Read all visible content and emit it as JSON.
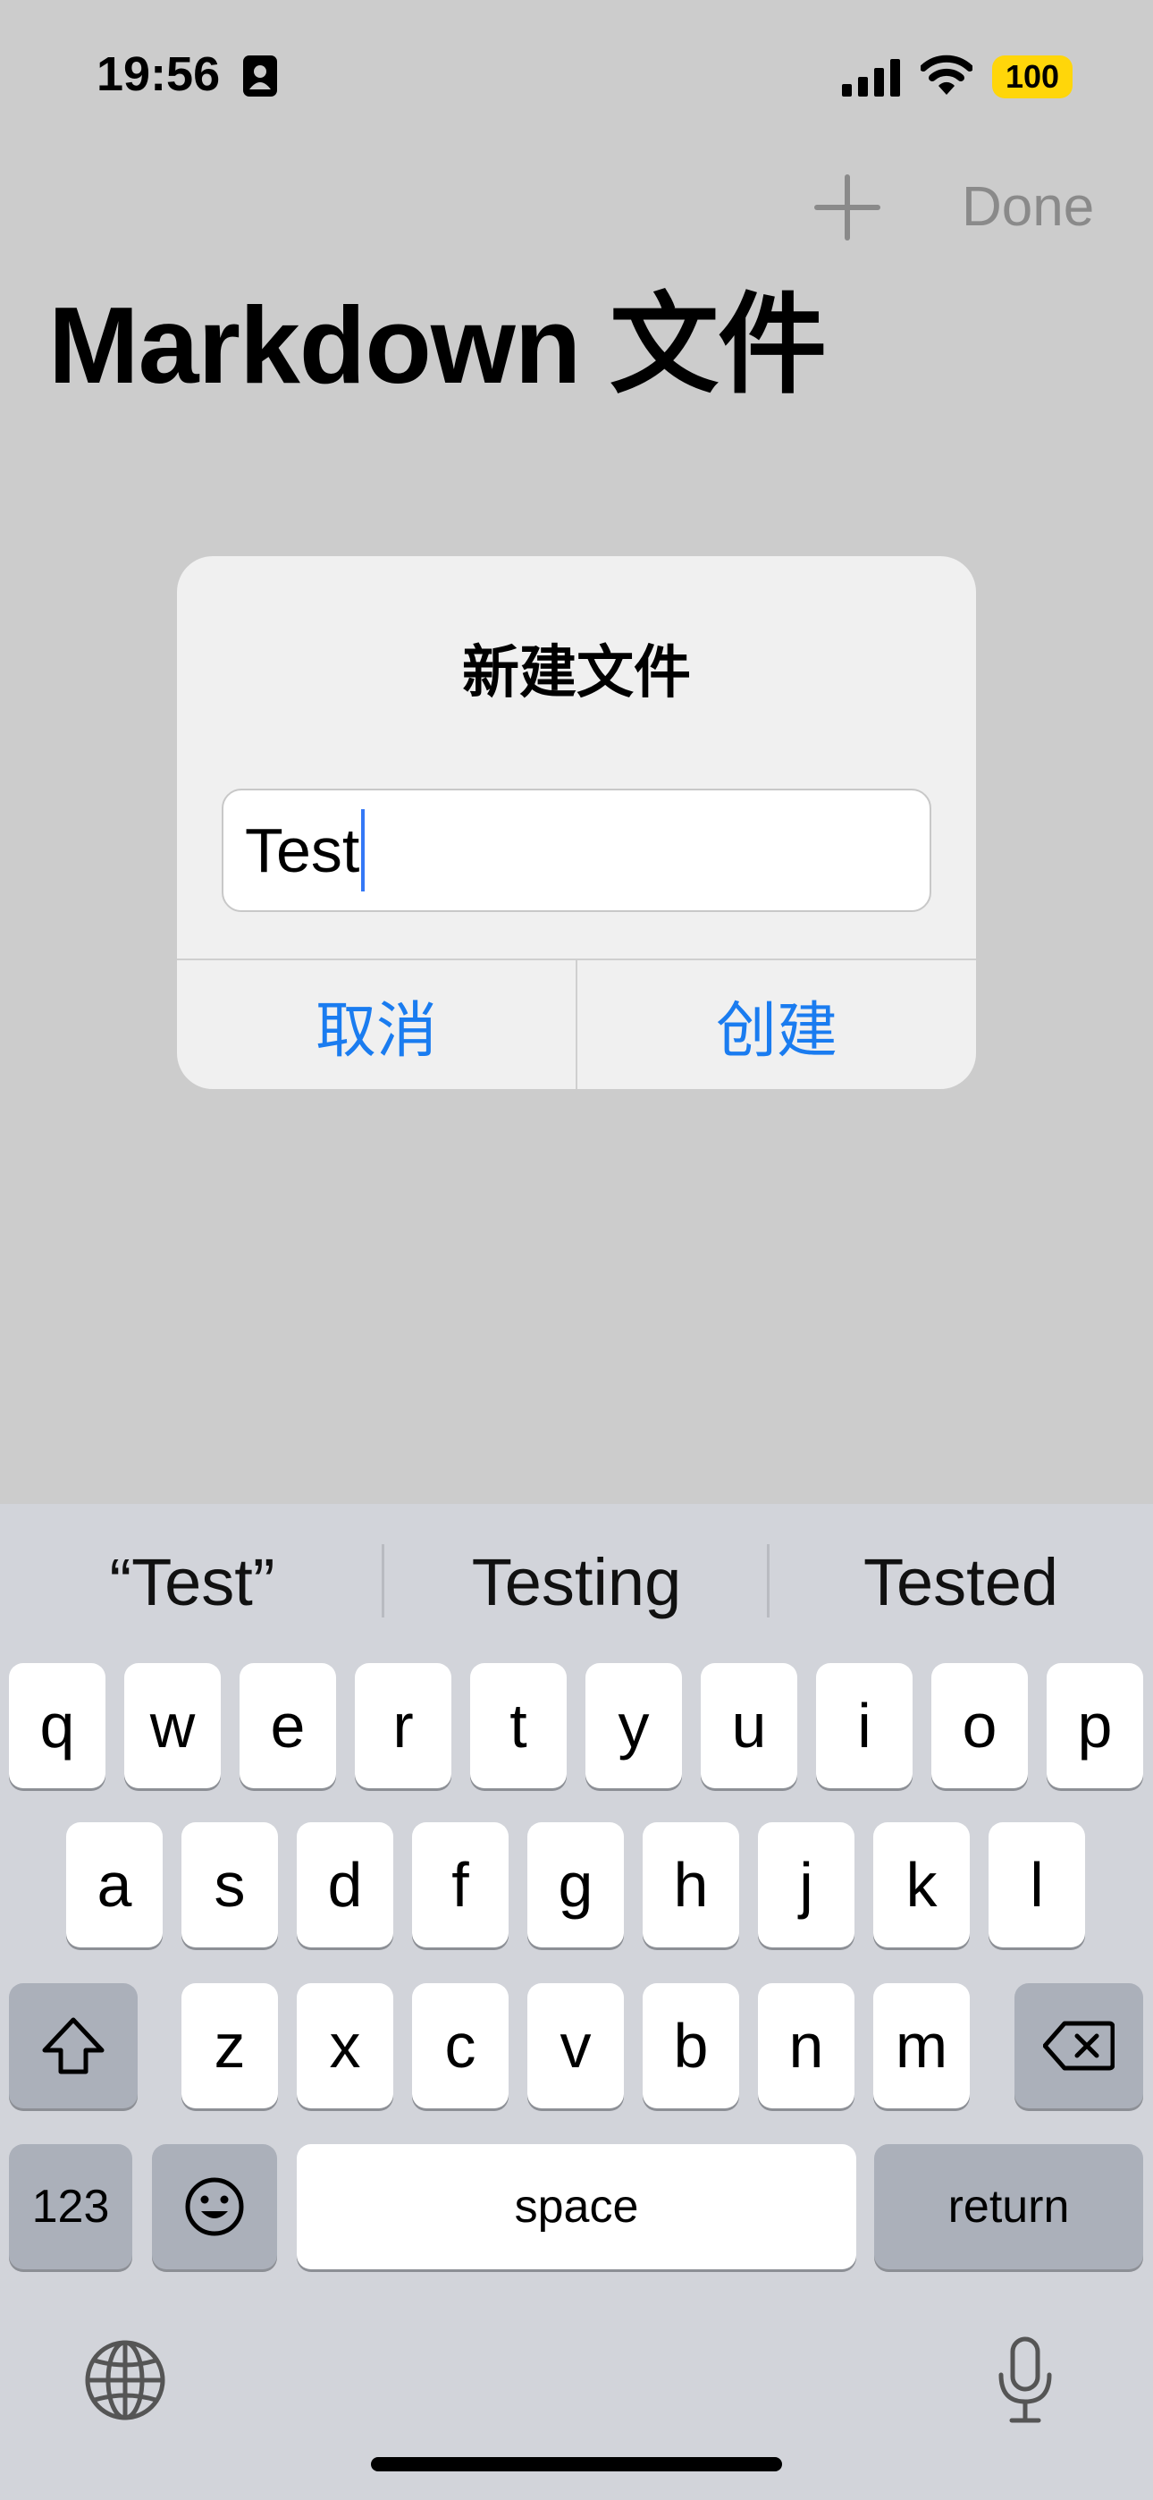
{
  "status_bar": {
    "time": "19:56",
    "battery": "100",
    "icons": [
      "contact-card-icon",
      "cellular-signal-icon",
      "wifi-icon",
      "battery-icon"
    ]
  },
  "nav": {
    "add_icon": "plus-icon",
    "done_label": "Done",
    "title": "Markdown 文件"
  },
  "alert": {
    "title": "新建文件",
    "input_value": "Test",
    "cancel_label": "取消",
    "create_label": "创建"
  },
  "keyboard": {
    "suggestions": [
      "“Test”",
      "Testing",
      "Tested"
    ],
    "row1": [
      "q",
      "w",
      "e",
      "r",
      "t",
      "y",
      "u",
      "i",
      "o",
      "p"
    ],
    "row2": [
      "a",
      "s",
      "d",
      "f",
      "g",
      "h",
      "j",
      "k",
      "l"
    ],
    "row3": [
      "z",
      "x",
      "c",
      "v",
      "b",
      "n",
      "m"
    ],
    "numbers_label": "123",
    "space_label": "space",
    "return_label": "return",
    "icons": [
      "shift-icon",
      "backspace-icon",
      "emoji-icon",
      "globe-icon",
      "microphone-icon"
    ]
  },
  "colors": {
    "background": "#cccccc",
    "accent": "#1a7cf0",
    "battery": "#ffd60a",
    "keyboard_bg": "#d2d4da"
  }
}
